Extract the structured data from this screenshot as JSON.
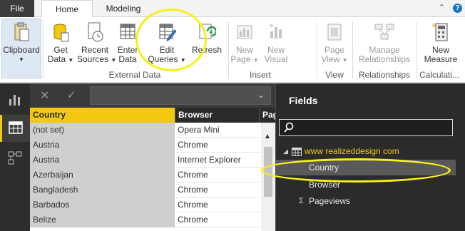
{
  "menubar": {
    "file": "File",
    "tabs": [
      "Home",
      "Modeling"
    ]
  },
  "ribbon": {
    "clipboard": {
      "label": "Clipboard"
    },
    "get_data": {
      "line1": "Get",
      "line2": "Data"
    },
    "recent_sources": {
      "line1": "Recent",
      "line2": "Sources"
    },
    "enter_data": {
      "line1": "Enter",
      "line2": "Data"
    },
    "edit_queries": {
      "line1": "Edit",
      "line2": "Queries"
    },
    "refresh": {
      "label": "Refresh"
    },
    "new_page": {
      "line1": "New",
      "line2": "Page"
    },
    "new_visual": {
      "line1": "New",
      "line2": "Visual"
    },
    "page_view": {
      "line1": "Page",
      "line2": "View"
    },
    "manage_relationships": {
      "line1": "Manage",
      "line2": "Relationships"
    },
    "new_measure": {
      "line1": "New",
      "line2": "Measure"
    },
    "groups": {
      "external_data": "External Data",
      "insert": "Insert",
      "view": "View",
      "relationships": "Relationships",
      "calculations": "Calculati..."
    }
  },
  "grid": {
    "columns": [
      "Country",
      "Browser",
      "Page"
    ],
    "rows": [
      {
        "country": "(not set)",
        "browser": "Opera Mini"
      },
      {
        "country": "Austria",
        "browser": "Chrome"
      },
      {
        "country": "Austria",
        "browser": "Internet Explorer"
      },
      {
        "country": "Azerbaijan",
        "browser": "Chrome"
      },
      {
        "country": "Bangladesh",
        "browser": "Chrome"
      },
      {
        "country": "Barbados",
        "browser": "Chrome"
      },
      {
        "country": "Belize",
        "browser": "Chrome"
      }
    ]
  },
  "fields": {
    "title": "Fields",
    "table_name": "www realizeddesign com",
    "items": [
      "Country",
      "Browser",
      "Pageviews"
    ]
  },
  "colors": {
    "accent_yellow": "#f2c811",
    "annotation": "#f6f01a",
    "dark_pane": "#2b2b2b"
  }
}
